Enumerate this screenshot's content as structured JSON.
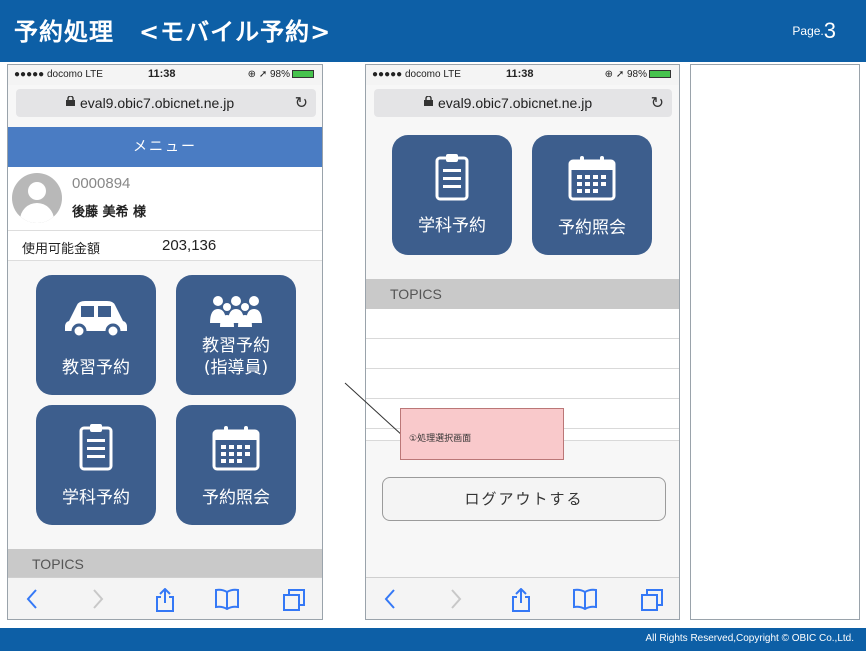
{
  "header": {
    "title": "予約処理　<モバイル予約>",
    "page_prefix": "Page.",
    "page_number": "3"
  },
  "footer": {
    "copyright": "All Rights Reserved,Copyright ©  OBIC Co.,Ltd."
  },
  "status_bar": {
    "carrier": "●●●●● docomo  LTE",
    "time": "11:38",
    "right": "⊕ ➚ 98%"
  },
  "browser": {
    "url": "eval9.obic7.obicnet.ne.jp",
    "reload": "↻"
  },
  "phone1": {
    "menu_title": "メニュー",
    "user_id": "0000894",
    "user_name": "後藤 美希 様",
    "balance_label": "使用可能金額",
    "balance_value": "203,136",
    "tiles": [
      {
        "label": "教習予約",
        "icon": "car-icon"
      },
      {
        "label": "教習予約\n(指導員)",
        "icon": "people-icon"
      },
      {
        "label": "学科予約",
        "icon": "clipboard-icon"
      },
      {
        "label": "予約照会",
        "icon": "calendar-icon"
      }
    ],
    "topics_label": "TOPICS"
  },
  "phone2": {
    "tiles": [
      {
        "label": "学科予約",
        "icon": "clipboard-icon"
      },
      {
        "label": "予約照会",
        "icon": "calendar-icon"
      }
    ],
    "topics_label": "TOPICS",
    "logout_label": "ログアウトする"
  },
  "annotation": {
    "text": "①処理選択画面"
  },
  "toolbar": {
    "back": "‹",
    "forward": "›"
  },
  "colors": {
    "brand_blue": "#0d5fa6",
    "menu_blue": "#4a7cc3",
    "tile_blue": "#3d5e8d",
    "callout_pink": "#f9c9cb"
  }
}
